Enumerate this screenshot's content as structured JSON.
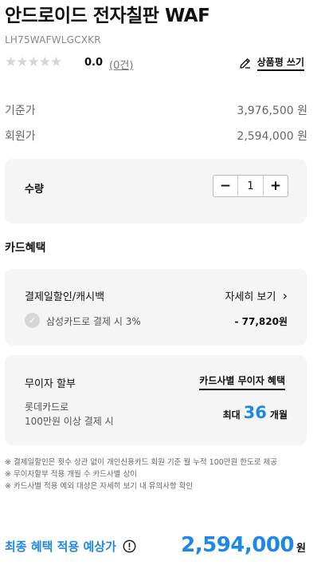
{
  "product": {
    "title": "안드로이드 전자칠판 WAF",
    "code": "LH75WAFWLGCXKR"
  },
  "rating": {
    "stars": "★★★★★",
    "score": "0.0",
    "count": "(0건)",
    "review_label": "상품평 쓰기"
  },
  "prices": {
    "base_label": "기준가",
    "base_value": "3,976,500 원",
    "member_label": "회원가",
    "member_value": "2,594,000 원"
  },
  "quantity": {
    "label": "수량",
    "minus": "−",
    "value": "1",
    "plus": "+"
  },
  "card_benefit": {
    "section_title": "카드혜택",
    "payment_label": "결제일할인/캐시백",
    "detail_label": "자세히 보기",
    "detail_chevron": "›",
    "check_mark": "✓",
    "samsung_text": "삼성카드로 결제 시 3%",
    "samsung_discount": "- 77,820원"
  },
  "no_interest": {
    "label": "무이자 할부",
    "link": "카드사별 무이자 혜택",
    "card_line1": "롯데카드로",
    "card_line2": "100만원 이상 결제 시",
    "max_prefix": "최대",
    "max_number": "36",
    "max_suffix": "개월"
  },
  "notes": [
    "※ 결제일할인은 횟수 상관 없이 개인신용카드 회원 기준 월 누적 100만원 한도로 제공",
    "※ 무이자할부 적용 개월 수 카드사별 상이",
    "※ 카드사별 적용 예외 대상은 자세히 보기 내 유의사항 확인"
  ],
  "final": {
    "label": "최종 혜택 적용 예상가",
    "price": "2,594,000",
    "unit": "원"
  },
  "colors": {
    "accent": "#1e88e5",
    "card_bg": "#f5f5f5",
    "star_empty": "#d5d5d5"
  },
  "icons": {
    "review": "pencil-icon",
    "info": "info-icon",
    "check": "check-circle-icon",
    "detail": "chevron-right-icon"
  }
}
